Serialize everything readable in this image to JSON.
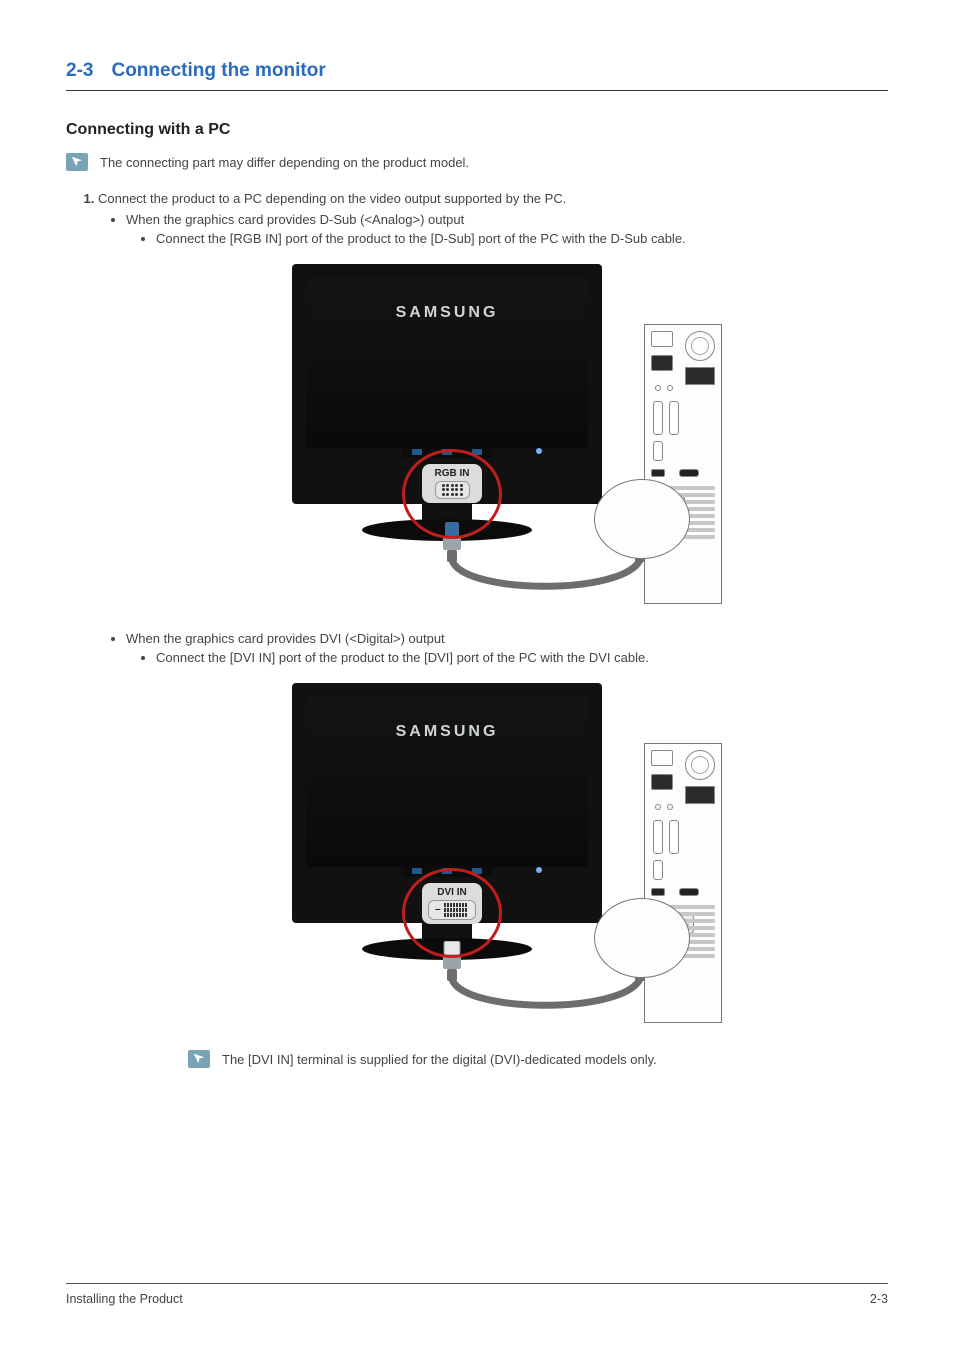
{
  "section": {
    "number": "2-3",
    "title": "Connecting the monitor"
  },
  "subheading": "Connecting with a PC",
  "note1": "The connecting part may differ depending on the product model.",
  "step1": {
    "marker": "1.",
    "text": "Connect the product to a PC depending on the video output supported by the PC.",
    "case_dsub": {
      "heading": "When the graphics card provides D-Sub (<Analog>) output",
      "instruction": "Connect the [RGB IN] port of the product to the [D-Sub] port of the PC with the D-Sub cable."
    },
    "case_dvi": {
      "heading": "When the graphics card provides DVI (<Digital>) output",
      "instruction": "Connect the [DVI IN] port of the product to the [DVI] port of the PC with the DVI cable."
    }
  },
  "note2": "The [DVI IN] terminal is supplied for the digital (DVI)-dedicated models only.",
  "figure_common": {
    "brand": "SAMSUNG"
  },
  "figure1": {
    "port_label": "RGB IN",
    "connector_type": "vga"
  },
  "figure2": {
    "port_label": "DVI IN",
    "connector_type": "dvi"
  },
  "footer": {
    "left": "Installing the Product",
    "right": "2-3"
  }
}
